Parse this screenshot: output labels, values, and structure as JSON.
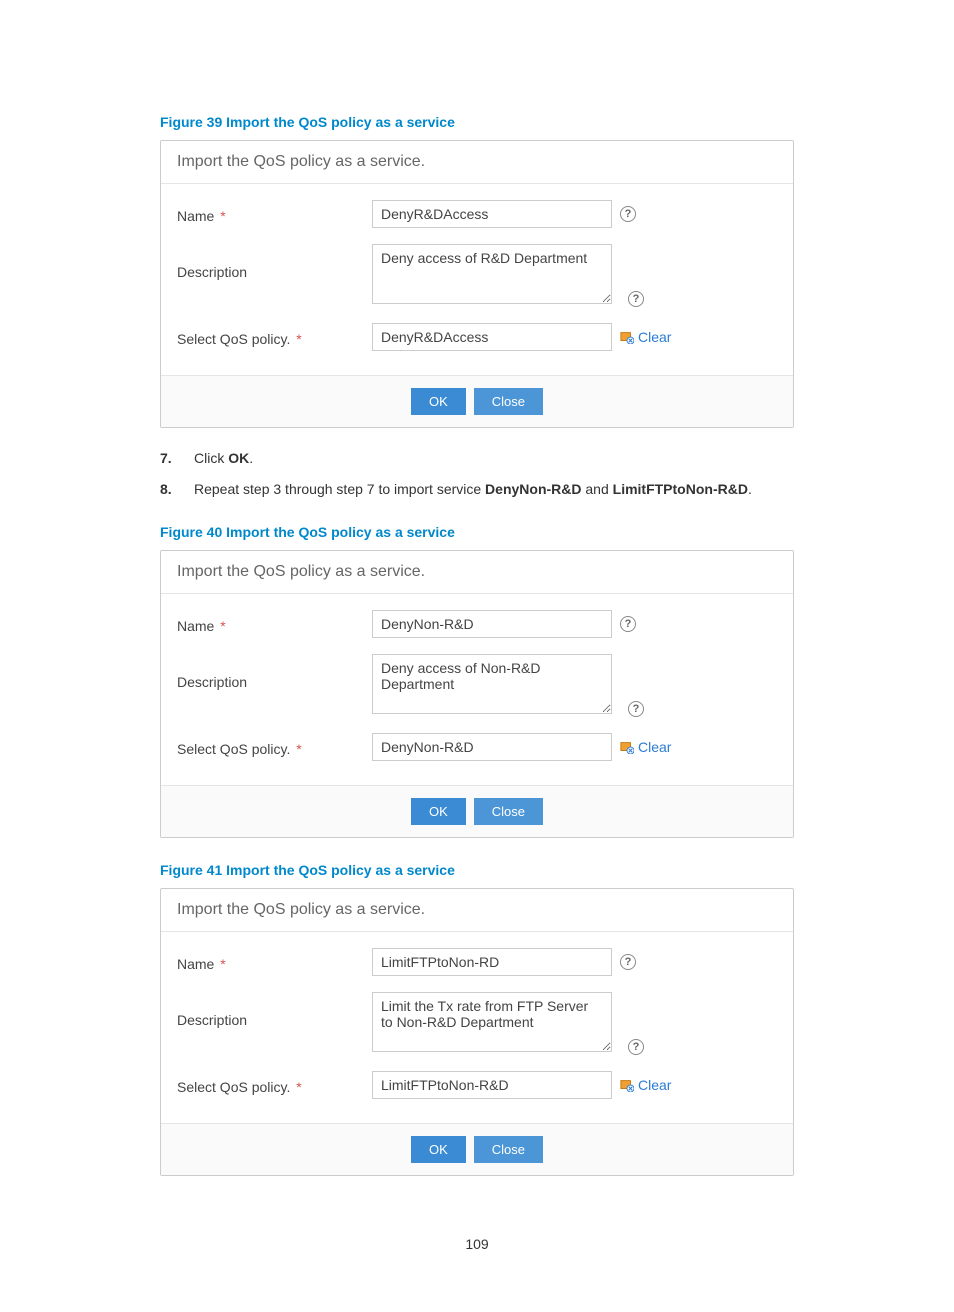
{
  "page_number": "109",
  "figures": [
    {
      "caption": "Figure 39 Import the QoS policy as a service"
    },
    {
      "caption": "Figure 40 Import the QoS policy as a service"
    },
    {
      "caption": "Figure 41 Import the QoS policy as a service"
    }
  ],
  "dialog": {
    "title": "Import the QoS policy as a service.",
    "labels": {
      "name": "Name",
      "description": "Description",
      "select_policy": "Select QoS policy."
    },
    "buttons": {
      "ok": "OK",
      "close": "Close",
      "clear": "Clear"
    }
  },
  "forms": [
    {
      "name": "DenyR&DAccess",
      "description": "Deny access of R&D Department",
      "policy": "DenyR&DAccess"
    },
    {
      "name": "DenyNon-R&D",
      "description": "Deny access of Non-R&D Department",
      "policy": "DenyNon-R&D"
    },
    {
      "name": "LimitFTPtoNon-RD",
      "description": "Limit the Tx rate from FTP Server to Non-R&D Department",
      "policy": "LimitFTPtoNon-R&D"
    }
  ],
  "steps": [
    {
      "num": "7.",
      "prefix": "Click ",
      "bold1": "OK",
      "mid": ".",
      "bold2": "",
      "mid2": "",
      "bold3": "",
      "suffix": ""
    },
    {
      "num": "8.",
      "prefix": "Repeat step 3 through step 7 to import service ",
      "bold1": "DenyNon-R&D",
      "mid": " and ",
      "bold2": "LimitFTPtoNon-R&D",
      "mid2": ".",
      "bold3": "",
      "suffix": ""
    }
  ]
}
